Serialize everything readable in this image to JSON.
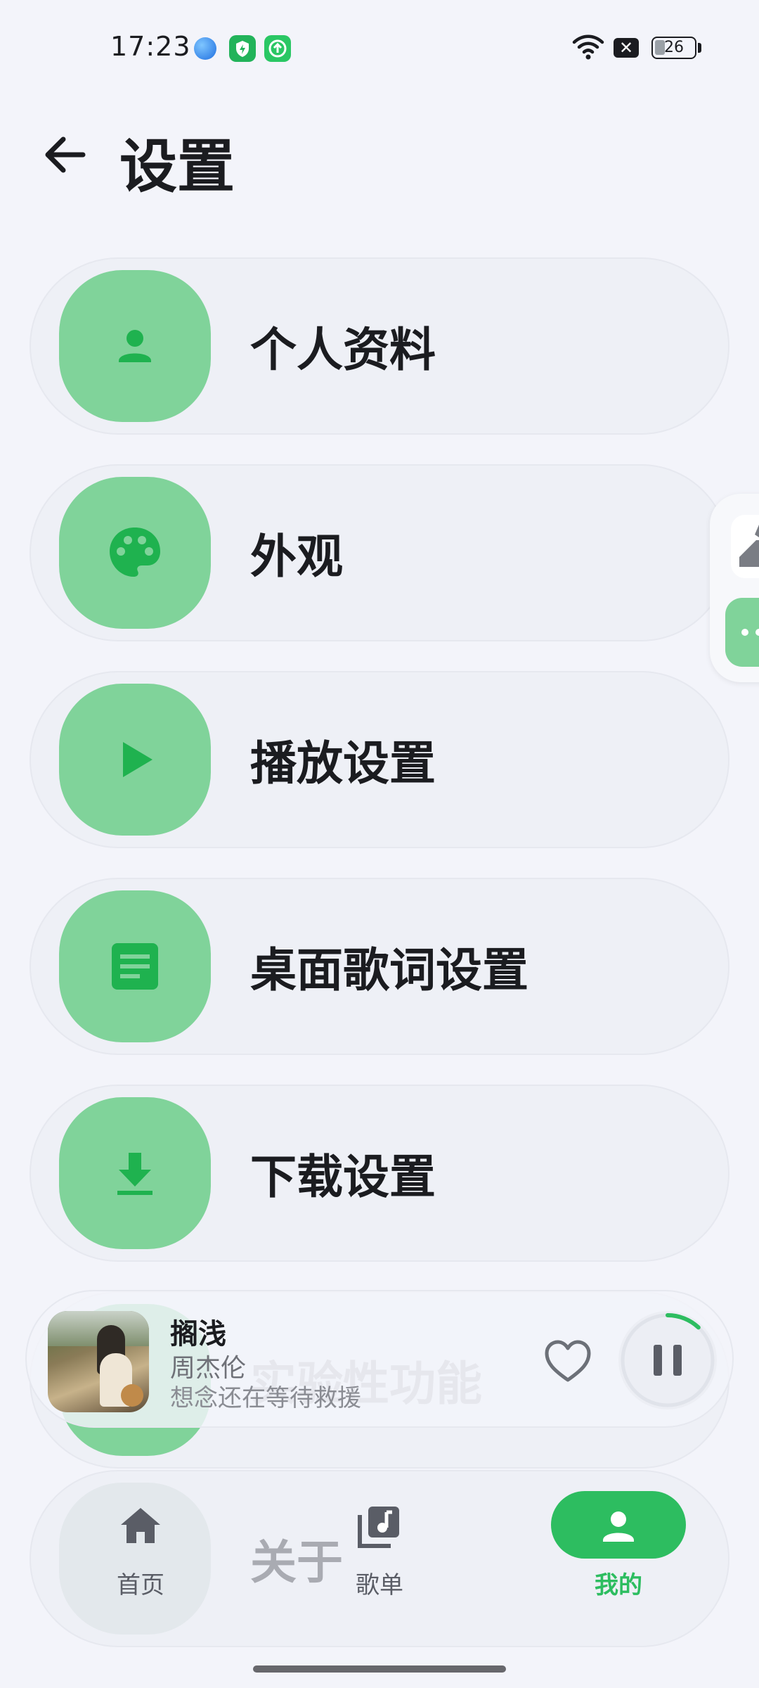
{
  "status_bar": {
    "time": "17:23",
    "battery": "26"
  },
  "header": {
    "title": "设置",
    "back_icon": "arrow-back-icon"
  },
  "settings": [
    {
      "label": "个人资料",
      "icon": "person-icon"
    },
    {
      "label": "外观",
      "icon": "palette-icon"
    },
    {
      "label": "播放设置",
      "icon": "play-icon"
    },
    {
      "label": "桌面歌词设置",
      "icon": "lyrics-icon"
    },
    {
      "label": "下载设置",
      "icon": "download-icon"
    },
    {
      "label": "实验性功能",
      "icon": "experiment-icon"
    },
    {
      "label": "关于",
      "icon": "info-icon"
    }
  ],
  "mini_player": {
    "title": "搁浅",
    "artist": "周杰伦",
    "lyric": "想念还在等待救援",
    "progress": 0.12
  },
  "bottom_nav": [
    {
      "label": "首页",
      "icon": "home-icon",
      "active": false
    },
    {
      "label": "歌单",
      "icon": "playlist-icon",
      "active": false
    },
    {
      "label": "我的",
      "icon": "person-icon",
      "active": true
    }
  ],
  "colors": {
    "accent": "#2dbd60",
    "icon_bg": "#80d39a",
    "background": "#f3f4fa"
  }
}
